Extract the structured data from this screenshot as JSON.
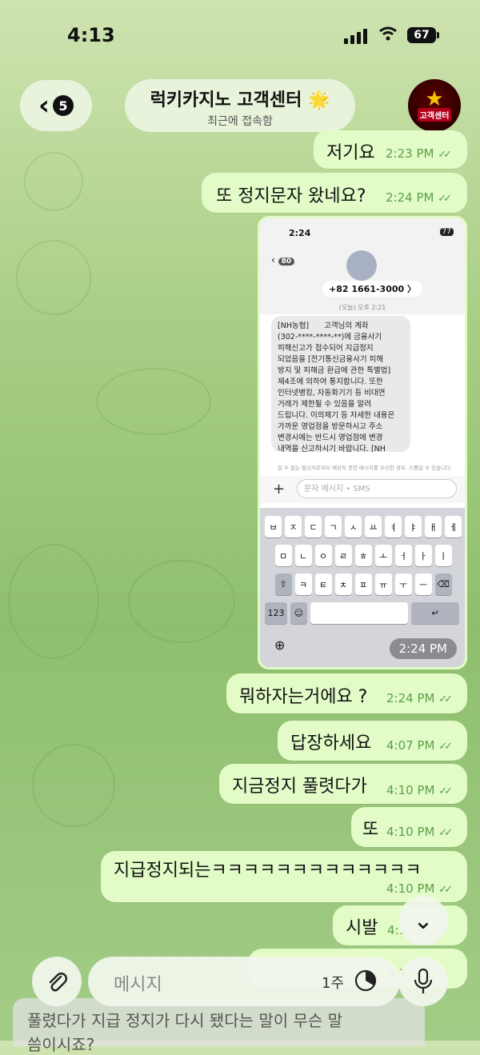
{
  "status_bar": {
    "time": "4:13",
    "battery": "67"
  },
  "header": {
    "unread_count": "5",
    "title": "럭키카지노 고객센터 🌟",
    "subtitle": "최근에 접속함",
    "avatar_text": "고객센터"
  },
  "messages": [
    {
      "text": "저기요",
      "time": "2:23 PM"
    },
    {
      "text": "또 정지문자 왔네요?",
      "time": "2:24 PM"
    },
    {
      "text": "뭐하자는거에요 ?",
      "time": "2:24 PM"
    },
    {
      "text": "답장하세요",
      "time": "4:07 PM"
    },
    {
      "text": "지금정지 풀렷다가",
      "time": "4:10 PM"
    },
    {
      "text": "또",
      "time": "4:10 PM"
    },
    {
      "text": "지급정지되는ㅋㅋㅋㅋㅋㅋㅋㅋㅋㅋㅋㅋㅋ",
      "time": "4:10 PM"
    },
    {
      "text": "시발",
      "time": "4:1"
    },
    {
      "text": "",
      "time": "4:1"
    }
  ],
  "image_message": {
    "time": "2:24 PM",
    "phone_time": "2:24",
    "phone_battery": "77",
    "back_count": "80",
    "sender": "+82 1661-3000 〉",
    "date": "(오늘) 오후 2:21",
    "sms": "[NH농협]  고객님의 계좌\n(302-****-****-**)에 금융사기\n피해신고가 접수되어 지급정지\n되었음을 [전기통신금융사기 피해\n방지 및 피해금 환급에 관한 특별법]\n제4조에 의하여 통지합니다. 또한\n인터넷뱅킹, 자동화기기 등 비대면\n거래가 제한될 수 있음을 알려\n드립니다. 이의제기 등 자세한 내용은\n가까운 영업점을 방문하시고 주소\n변경시에는 반드시 영업점에 변경\n내역을 신고하시기 바랍니다. [NH",
    "note": "알 수 없는 발신자로부터 예상치 못한 메시지를 수신한 경우, 스팸일 수 있습니다.",
    "input_placeholder": "문자 메시지 • SMS",
    "kb_row1": [
      "ㅂ",
      "ㅈ",
      "ㄷ",
      "ㄱ",
      "ㅅ",
      "ㅛ",
      "ㅕ",
      "ㅑ",
      "ㅐ",
      "ㅔ"
    ],
    "kb_row2": [
      "ㅁ",
      "ㄴ",
      "ㅇ",
      "ㄹ",
      "ㅎ",
      "ㅗ",
      "ㅓ",
      "ㅏ",
      "ㅣ"
    ],
    "kb_row3": [
      "ㅋ",
      "ㅌ",
      "ㅊ",
      "ㅍ",
      "ㅠ",
      "ㅜ",
      "ㅡ"
    ],
    "kb_123": "123"
  },
  "composer": {
    "placeholder": "메시지",
    "timer": "1주"
  },
  "draft": {
    "line1": "풀렸다가 지급 정지가 다시 됐다는 말이 무슨 말",
    "line2": "씀이시죠?"
  },
  "colors": {
    "bubble_out": "#e2fbc7",
    "meta": "#5aa04a"
  }
}
